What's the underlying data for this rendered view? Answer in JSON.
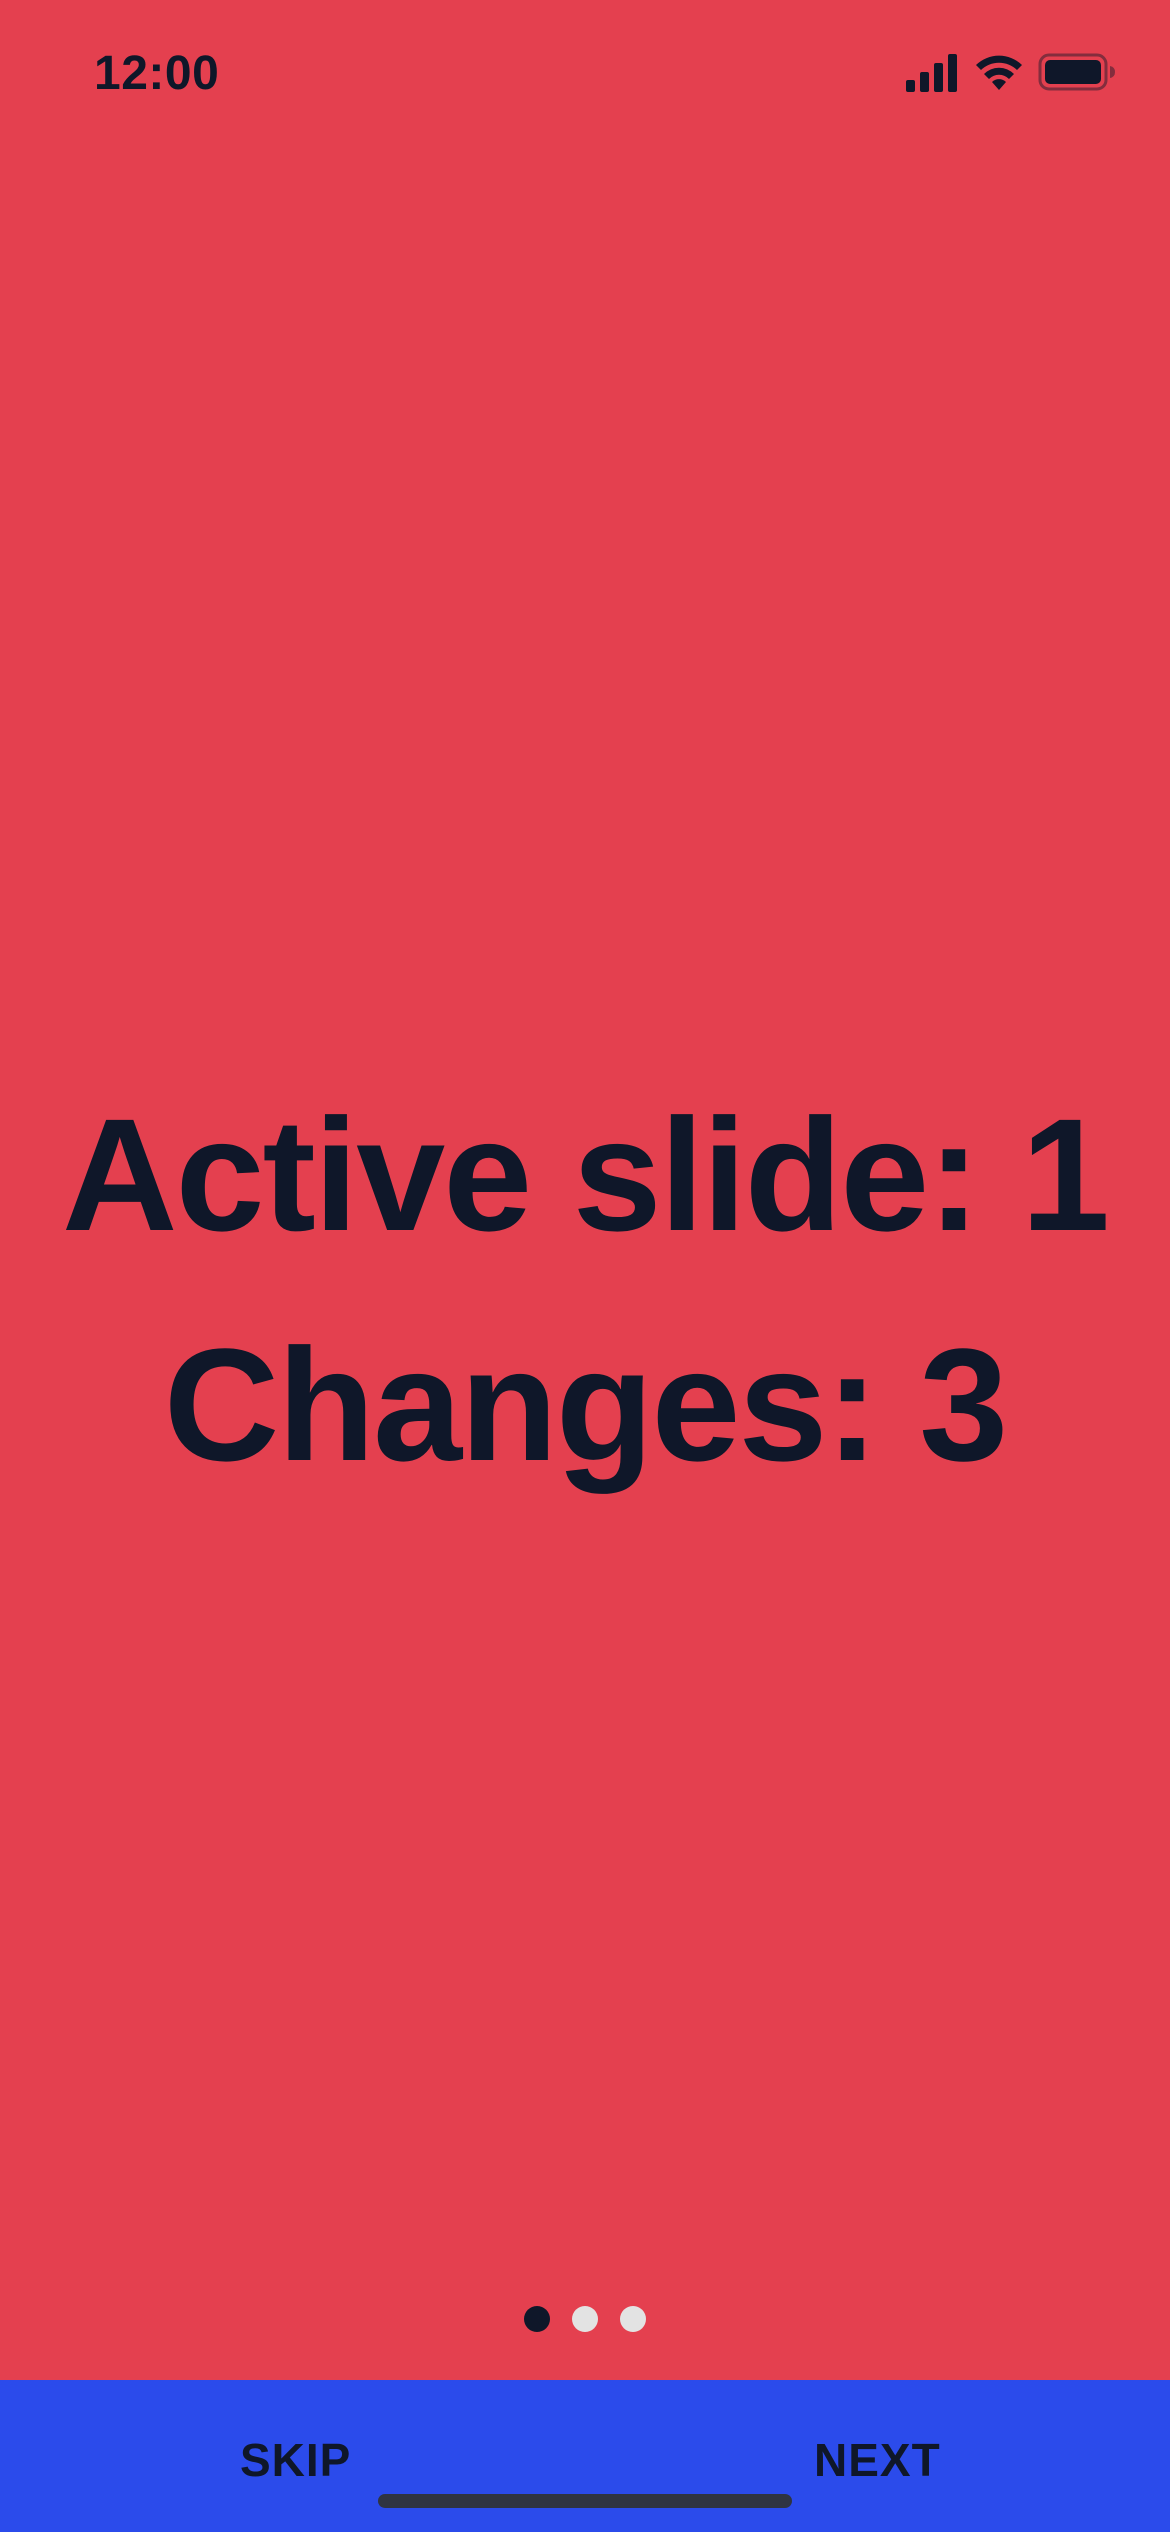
{
  "status_bar": {
    "time": "12:00",
    "icons": [
      "signal-icon",
      "wifi-icon",
      "battery-icon"
    ]
  },
  "slide": {
    "line1": "Active slide: 1",
    "line2": "Changes: 3"
  },
  "pagination": {
    "total": 3,
    "active_index": 0
  },
  "bottom_bar": {
    "skip_label": "SKIP",
    "next_label": "NEXT"
  },
  "colors": {
    "background": "#e4404f",
    "text": "#0f1729",
    "bottom_bar": "#2b4beb",
    "dot_active": "#0f1729",
    "dot_inactive": "#e3e3e3"
  }
}
